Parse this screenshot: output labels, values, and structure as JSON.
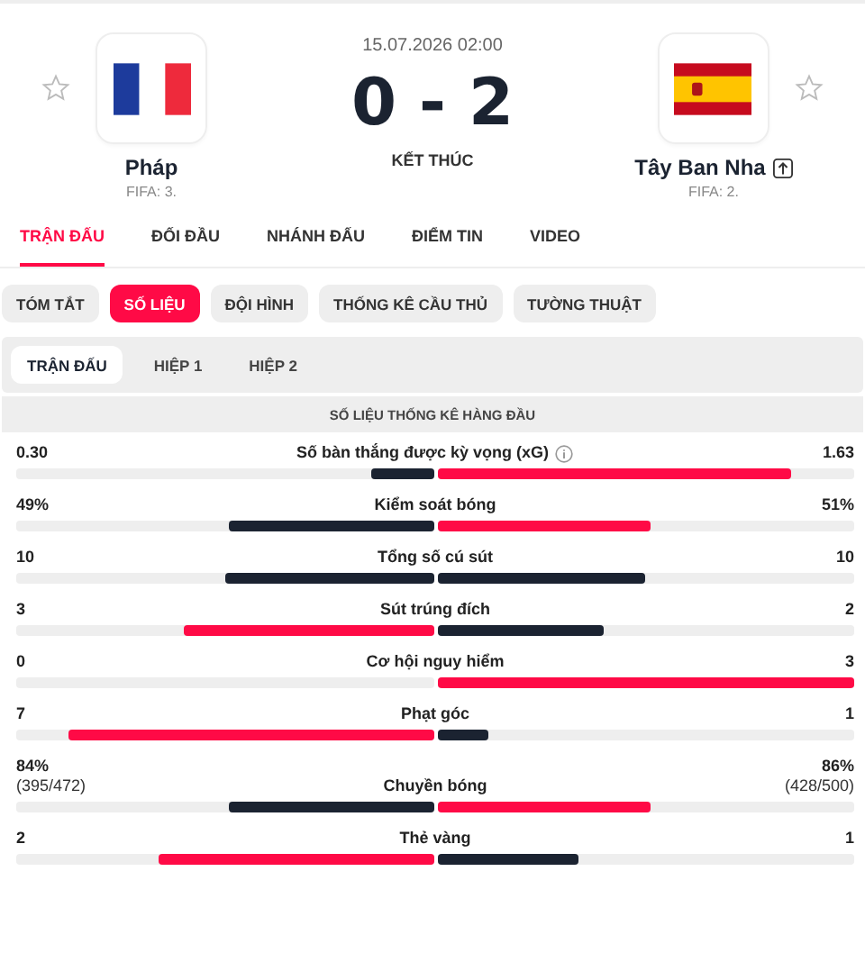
{
  "match": {
    "date": "15.07.2026 02:00",
    "score": "0 - 2",
    "status": "KẾT THÚC",
    "home": {
      "name": "Pháp",
      "rank": "FIFA: 3.",
      "kind": "france",
      "promoted": false
    },
    "away": {
      "name": "Tây Ban Nha",
      "rank": "FIFA: 2.",
      "kind": "spain",
      "promoted": true
    }
  },
  "tabs": [
    {
      "label": "TRẬN ĐẤU",
      "selected": true
    },
    {
      "label": "ĐỐI ĐẦU",
      "selected": false
    },
    {
      "label": "NHÁNH ĐẤU",
      "selected": false
    },
    {
      "label": "ĐIỂM TIN",
      "selected": false
    },
    {
      "label": "VIDEO",
      "selected": false
    }
  ],
  "subtabs": [
    {
      "label": "TÓM TẮT",
      "selected": false
    },
    {
      "label": "SỐ LIỆU",
      "selected": true
    },
    {
      "label": "ĐỘI HÌNH",
      "selected": false
    },
    {
      "label": "THỐNG KÊ CẦU THỦ",
      "selected": false
    },
    {
      "label": "TƯỜNG THUẬT",
      "selected": false
    }
  ],
  "periods": [
    {
      "label": "TRẬN ĐẤU",
      "selected": true
    },
    {
      "label": "HIỆP 1",
      "selected": false
    },
    {
      "label": "HIỆP 2",
      "selected": false
    }
  ],
  "section_title": "SỐ LIỆU THỐNG KÊ HÀNG ĐẦU",
  "stats": [
    {
      "label": "Số bàn thắng được kỳ vọng (xG)",
      "info": true,
      "home": {
        "value": "0.30",
        "level": 0.15,
        "highlighted": false
      },
      "away": {
        "value": "1.63",
        "level": 0.85,
        "highlighted": true
      }
    },
    {
      "label": "Kiểm soát bóng",
      "info": false,
      "home": {
        "value": "49%",
        "level": 0.49,
        "highlighted": false
      },
      "away": {
        "value": "51%",
        "level": 0.51,
        "highlighted": true
      }
    },
    {
      "label": "Tổng số cú sút",
      "info": false,
      "home": {
        "value": "10",
        "level": 0.5,
        "highlighted": false
      },
      "away": {
        "value": "10",
        "level": 0.5,
        "highlighted": false
      }
    },
    {
      "label": "Sút trúng đích",
      "info": false,
      "home": {
        "value": "3",
        "level": 0.6,
        "highlighted": true
      },
      "away": {
        "value": "2",
        "level": 0.4,
        "highlighted": false
      }
    },
    {
      "label": "Cơ hội nguy hiểm",
      "info": false,
      "home": {
        "value": "0"
      },
      "away": {
        "value": "3",
        "level": 1,
        "highlighted": true
      }
    },
    {
      "label": "Phạt góc",
      "info": false,
      "home": {
        "value": "7",
        "level": 0.875,
        "highlighted": true
      },
      "away": {
        "value": "1",
        "level": 0.125,
        "highlighted": false
      }
    },
    {
      "label": "Chuyền bóng",
      "info": false,
      "home": {
        "value": "84%",
        "detail": "(395/472)",
        "level": 0.49,
        "highlighted": false
      },
      "away": {
        "value": "86%",
        "detail": "(428/500)",
        "level": 0.51,
        "highlighted": true
      }
    },
    {
      "label": "Thẻ vàng",
      "info": false,
      "home": {
        "value": "2",
        "level": 0.66,
        "highlighted": true
      },
      "away": {
        "value": "1",
        "level": 0.34,
        "highlighted": false
      }
    }
  ]
}
